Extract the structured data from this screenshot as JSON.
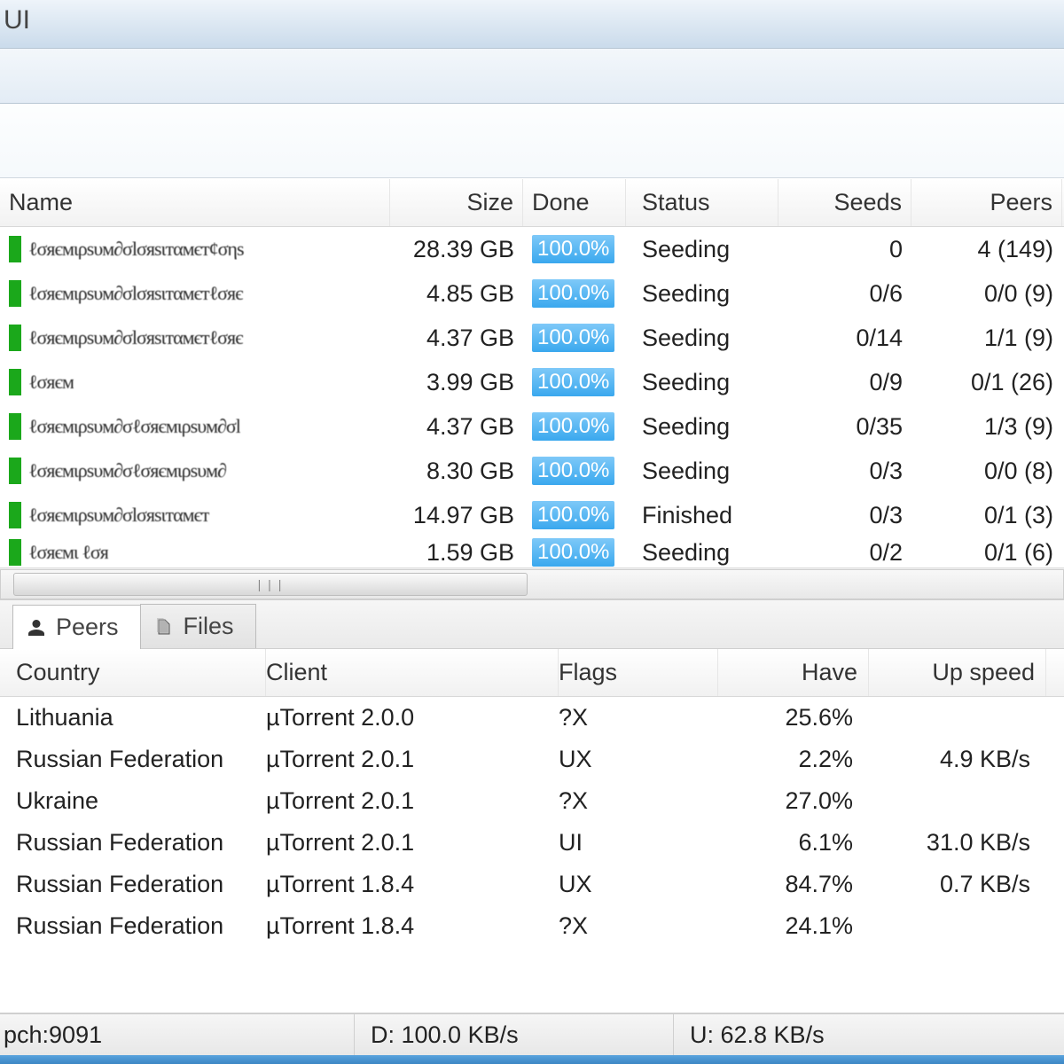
{
  "window": {
    "title_fragment": "UI"
  },
  "torrents": {
    "columns": {
      "name": "Name",
      "size": "Size",
      "done": "Done",
      "status": "Status",
      "seeds": "Seeds",
      "peers": "Peers"
    },
    "rows": [
      {
        "size": "28.39 GB",
        "done": "100.0%",
        "status": "Seeding",
        "seeds": "0",
        "peers": "4 (149)"
      },
      {
        "size": "4.85 GB",
        "done": "100.0%",
        "status": "Seeding",
        "seeds": "0/6",
        "peers": "0/0 (9)"
      },
      {
        "size": "4.37 GB",
        "done": "100.0%",
        "status": "Seeding",
        "seeds": "0/14",
        "peers": "1/1 (9)"
      },
      {
        "size": "3.99 GB",
        "done": "100.0%",
        "status": "Seeding",
        "seeds": "0/9",
        "peers": "0/1 (26)"
      },
      {
        "size": "4.37 GB",
        "done": "100.0%",
        "status": "Seeding",
        "seeds": "0/35",
        "peers": "1/3 (9)"
      },
      {
        "size": "8.30 GB",
        "done": "100.0%",
        "status": "Seeding",
        "seeds": "0/3",
        "peers": "0/0 (8)"
      },
      {
        "size": "14.97 GB",
        "done": "100.0%",
        "status": "Finished",
        "seeds": "0/3",
        "peers": "0/1 (3)"
      },
      {
        "size": "1.59 GB",
        "done": "100.0%",
        "status": "Seeding",
        "seeds": "0/2",
        "peers": "0/1 (6)"
      }
    ]
  },
  "tabs": {
    "peers": "Peers",
    "files": "Files"
  },
  "peers": {
    "columns": {
      "country": "Country",
      "client": "Client",
      "flags": "Flags",
      "have": "Have",
      "up": "Up speed"
    },
    "rows": [
      {
        "country": "Lithuania",
        "client": "µTorrent 2.0.0",
        "flags": "?X",
        "have": "25.6%",
        "up": ""
      },
      {
        "country": "Russian Federation",
        "client": "µTorrent 2.0.1",
        "flags": "UX",
        "have": "2.2%",
        "up": "4.9 KB/s"
      },
      {
        "country": "Ukraine",
        "client": "µTorrent 2.0.1",
        "flags": "?X",
        "have": "27.0%",
        "up": ""
      },
      {
        "country": "Russian Federation",
        "client": "µTorrent 2.0.1",
        "flags": "UI",
        "have": "6.1%",
        "up": "31.0 KB/s"
      },
      {
        "country": "Russian Federation",
        "client": "µTorrent 1.8.4",
        "flags": "UX",
        "have": "84.7%",
        "up": "0.7 KB/s"
      },
      {
        "country": "Russian Federation",
        "client": "µTorrent 1.8.4",
        "flags": "?X",
        "have": "24.1%",
        "up": ""
      }
    ]
  },
  "statusbar": {
    "host": "pch:9091",
    "down": "D: 100.0 KB/s",
    "up": "U: 62.8 KB/s"
  }
}
